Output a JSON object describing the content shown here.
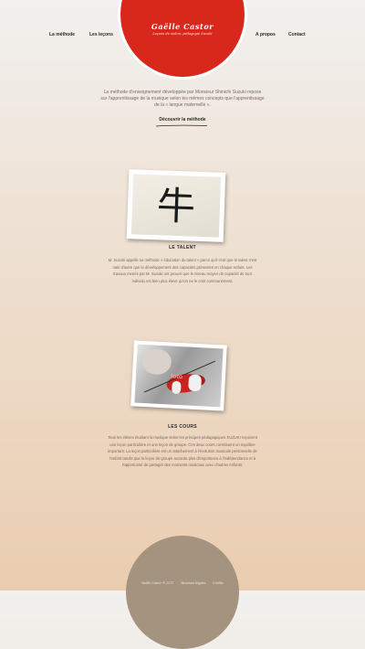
{
  "header": {
    "brand_title": "Gaëlle Castor",
    "brand_tagline": "Leçons de violon, pédagogie Suzuki",
    "nav": [
      "La méthode",
      "Les leçons",
      "A propos",
      "Contact"
    ]
  },
  "intro": {
    "text": "La méthode d'enseignement développée par Monsieur Shinichi Suzuki repose sur l'apprentissage de la musique selon les mêmes concepts que l'apprentissage de la « langue maternelle ».",
    "cta": "Découvrir la méthode"
  },
  "sections": [
    {
      "image_caption": "牛",
      "title": "LE TALENT",
      "text": "M. Suzuki appelle sa méthode « éducation du talent » parce qu'il croit que le talent n'est nain d'autre que le développement des capacités présentes en chaque enfant. Les travaux menés par M. Suzuki ont prouvé que le niveau moyen de capacité de tout individu est bien plus élevé qu'on ne le croit communément."
    },
    {
      "image_label": "foto",
      "title": "LES COURS",
      "text": "Tous les élèves étudiant la musique selon les principes pédagogiques SUZUKI reçoivent une leçon particulière et une leçon de groupe. Ces deux cours constituent un équilibre important. La leçon particulière est un attachement à l'évolution musicale personnelle de l'enfant tandis que la leçon de groupe accorde plus d'importance à l'indépendance et à l'opportunité de partager des moments musicaux avec d'autres enfants."
    }
  ],
  "footer": {
    "copyright": "Gaëlle Castor © 2011",
    "legal": "Mentions légales",
    "credits": "Crédits"
  },
  "colors": {
    "accent_red": "#d8281c",
    "footer_circle": "#a4937f"
  }
}
